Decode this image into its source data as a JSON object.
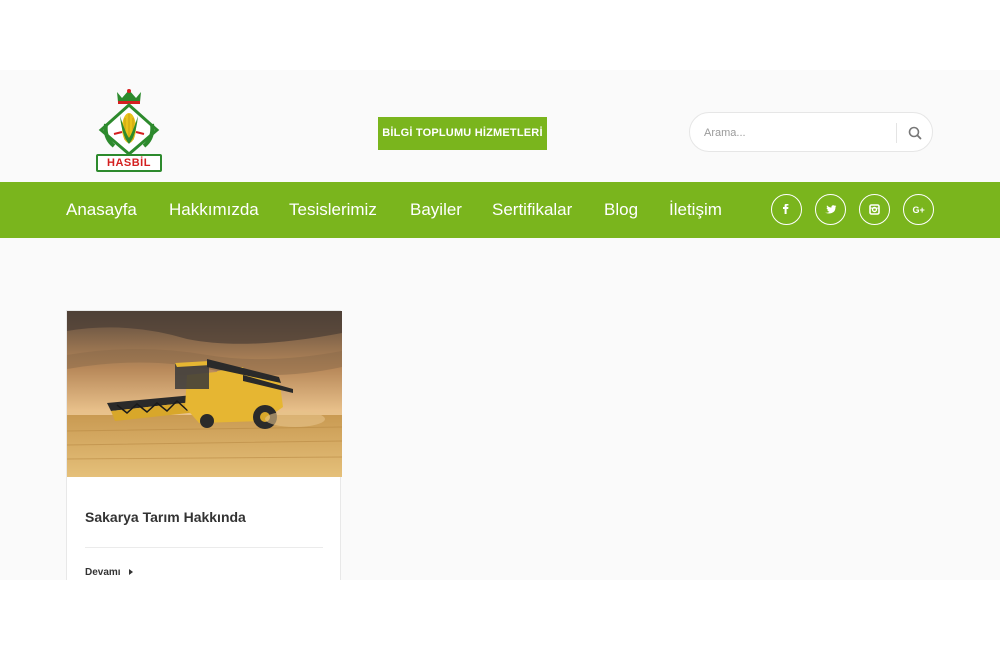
{
  "header": {
    "logo_text": "HASBİL",
    "cta_label": "BİLGİ TOPLUMU HİZMETLERİ",
    "search": {
      "placeholder": "Arama...",
      "icon": "search-icon"
    }
  },
  "nav": {
    "items": [
      {
        "label": "Anasayfa"
      },
      {
        "label": "Hakkımızda"
      },
      {
        "label": "Tesislerimiz"
      },
      {
        "label": "Bayiler"
      },
      {
        "label": "Sertifikalar"
      },
      {
        "label": "Blog"
      },
      {
        "label": "İletişim"
      }
    ],
    "social": [
      "facebook-icon",
      "twitter-icon",
      "instagram-icon",
      "google-plus-icon"
    ]
  },
  "posts": [
    {
      "title": "Sakarya Tarım Hakkında",
      "more_label": "Devamı",
      "image": "combine-harvester-photo"
    }
  ],
  "colors": {
    "brand_green": "#7ab51d",
    "logo_red": "#d42020",
    "logo_green": "#2d8a2d"
  }
}
